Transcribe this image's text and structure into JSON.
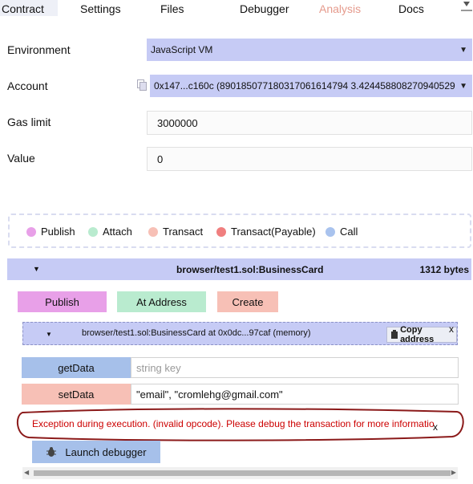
{
  "tabs": [
    {
      "label": "Contract"
    },
    {
      "label": "Settings"
    },
    {
      "label": "Files"
    },
    {
      "label": "Debugger"
    },
    {
      "label": "Analysis"
    },
    {
      "label": "Docs"
    }
  ],
  "form": {
    "environment_label": "Environment",
    "environment_value": "JavaScript VM",
    "account_label": "Account",
    "account_value": "0x147...c160c (890185077180317061614794 3.424458808270940529",
    "gas_label": "Gas limit",
    "gas_value": "3000000",
    "value_label": "Value",
    "value_value": "0"
  },
  "legend": [
    {
      "label": "Publish",
      "color": "#e8a0e8"
    },
    {
      "label": "Attach",
      "color": "#b9ebcf"
    },
    {
      "label": "Transact",
      "color": "#f7c0b6"
    },
    {
      "label": "Transact(Payable)",
      "color": "#f07f7f"
    },
    {
      "label": "Call",
      "color": "#a9c3ee"
    }
  ],
  "contract": {
    "name": "browser/test1.sol:BusinessCard",
    "size": "1312 bytes",
    "publish_label": "Publish",
    "at_address_label": "At Address",
    "create_label": "Create"
  },
  "instance": {
    "title": "browser/test1.sol:BusinessCard at 0x0dc...97caf (memory)",
    "copy_label": "Copy address",
    "close": "x",
    "functions": [
      {
        "name": "getData",
        "input": "",
        "placeholder": "string key"
      },
      {
        "name": "setData",
        "input": "\"email\", \"cromlehg@gmail.com\"",
        "placeholder": ""
      }
    ]
  },
  "error": {
    "text": "Exception during execution. (invalid opcode). Please debug the transaction for more informatio",
    "close": "x"
  },
  "debugger_button": "Launch debugger"
}
